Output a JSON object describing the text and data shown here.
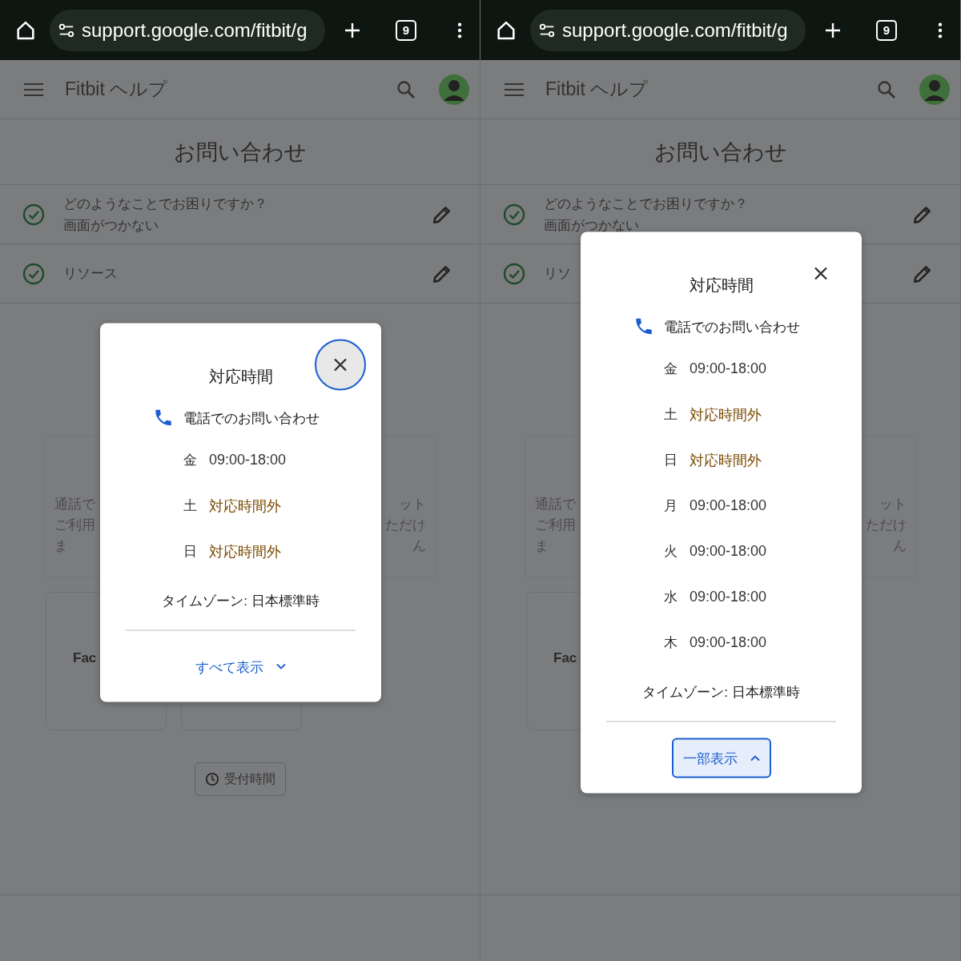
{
  "panes": [
    {
      "browser": {
        "url": "support.google.com/fitbit/g",
        "tab_count": "9"
      },
      "header": {
        "title": "Fitbit ヘルプ"
      },
      "page_title": "お問い合わせ",
      "steps": [
        {
          "question": "どのようなことでお困りですか？",
          "answer": "画面がつかない"
        },
        {
          "question": "リソース"
        }
      ],
      "cards_row1": [
        {
          "kind": "text",
          "lines": [
            "通話で",
            "ご利用",
            "ま"
          ]
        },
        {
          "kind": "text",
          "lines": [
            "ット",
            "ただけ",
            "ん"
          ]
        }
      ],
      "cards_row2": [
        {
          "kind": "text",
          "label": "Fac"
        },
        {
          "kind": "blank"
        }
      ],
      "hours_button": {
        "label": "受付時間"
      },
      "dialog": {
        "title": "対応時間",
        "close_focused": true,
        "phone_label": "電話でのお問い合わせ",
        "hours": [
          {
            "day": "金",
            "hours": "09:00-18:00",
            "kind": "open"
          },
          {
            "day": "土",
            "hours": "対応時間外",
            "kind": "closed"
          },
          {
            "day": "日",
            "hours": "対応時間外",
            "kind": "closed"
          }
        ],
        "timezone": "タイムゾーン: 日本標準時",
        "toggle": {
          "label": "すべて表示",
          "expanded": false,
          "focused": false
        }
      }
    },
    {
      "browser": {
        "url": "support.google.com/fitbit/g",
        "tab_count": "9"
      },
      "header": {
        "title": "Fitbit ヘルプ"
      },
      "page_title": "お問い合わせ",
      "steps": [
        {
          "question": "どのようなことでお困りですか？",
          "answer": "画面がつかない"
        },
        {
          "question": "リソ"
        }
      ],
      "cards_row1": [
        {
          "kind": "text",
          "lines": [
            "通話で",
            "ご利用",
            "ま"
          ]
        },
        {
          "kind": "text",
          "lines": [
            "ット",
            "ただけ",
            "ん"
          ]
        }
      ],
      "cards_row2": [
        {
          "kind": "text",
          "label": "Fac"
        }
      ],
      "dialog": {
        "title": "対応時間",
        "close_focused": false,
        "phone_label": "電話でのお問い合わせ",
        "hours": [
          {
            "day": "金",
            "hours": "09:00-18:00",
            "kind": "open"
          },
          {
            "day": "土",
            "hours": "対応時間外",
            "kind": "closed"
          },
          {
            "day": "日",
            "hours": "対応時間外",
            "kind": "closed"
          },
          {
            "day": "月",
            "hours": "09:00-18:00",
            "kind": "open"
          },
          {
            "day": "火",
            "hours": "09:00-18:00",
            "kind": "open"
          },
          {
            "day": "水",
            "hours": "09:00-18:00",
            "kind": "open"
          },
          {
            "day": "木",
            "hours": "09:00-18:00",
            "kind": "open"
          }
        ],
        "timezone": "タイムゾーン: 日本標準時",
        "toggle": {
          "label": "一部表示",
          "expanded": true,
          "focused": true
        }
      }
    }
  ]
}
